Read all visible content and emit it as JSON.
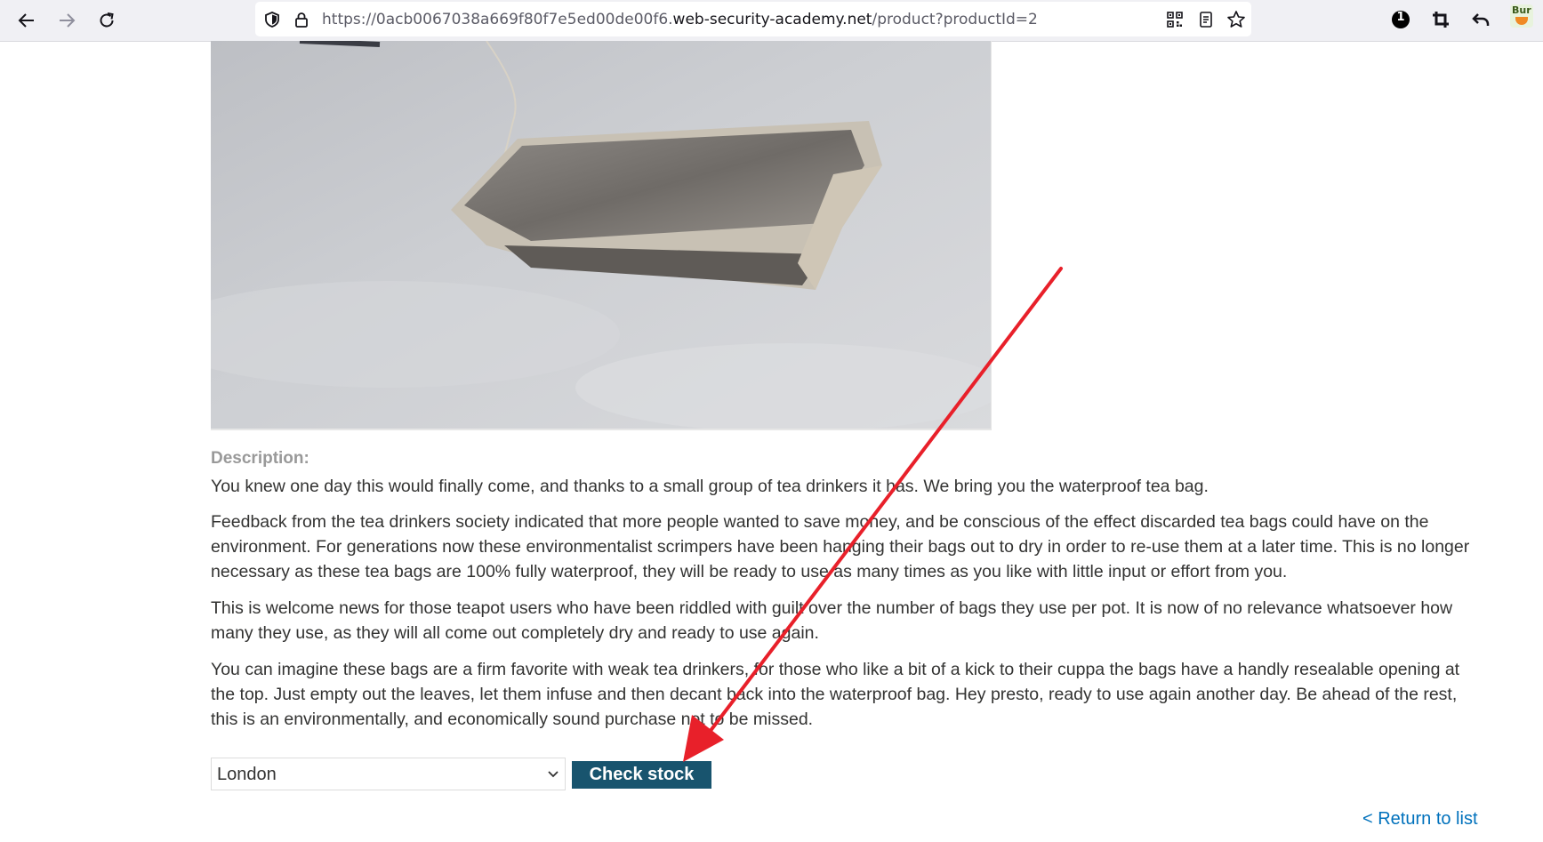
{
  "browser": {
    "url_prefix": "https://0acb0067038a669f80f7e5ed00de00f6.",
    "url_host": "web-security-academy.net",
    "url_path": "/product?productId=2",
    "extension_badge_count": "1",
    "burp_label": "Bur"
  },
  "product": {
    "description_heading": "Description:",
    "paragraphs": [
      "You knew one day this would finally come, and thanks to a small group of tea drinkers it has. We bring you the waterproof tea bag.",
      "Feedback from the tea drinkers society indicated that more people wanted to save money, and be conscious of the effect discarded tea bags could have on the environment. For generations now these environmentalist scrimpers have been hanging their bags out to dry in order to re-use them at a later time. This is no longer necessary as these tea bags are 100% fully waterproof, they will be ready to use as many times as you like with little input or effort from you.",
      "This is welcome news for those teapot users who have been riddled with guilt over the number of bags they use per pot. It is now of no relevance whatsoever how many they use, as they will all come out completely dry and ready to use again.",
      "You can imagine these bags are a firm favorite with weak tea drinkers, for those who like a bit of a kick to their cuppa the bags have a handly resealable opening at the top. Just empty out the leaves, let them infuse and then decant back into the waterproof bag. Hey presto, ready to use again another day. Be ahead of the rest, this is an environmentally, and economically sound purchase not to be missed."
    ]
  },
  "stock_check": {
    "selected_store": "London",
    "button_label": "Check stock"
  },
  "return_link_label": "< Return to list",
  "colors": {
    "button_bg": "#18546e",
    "link": "#0071bc",
    "annotation_arrow": "#e8202a",
    "heading_gray": "#999999"
  }
}
